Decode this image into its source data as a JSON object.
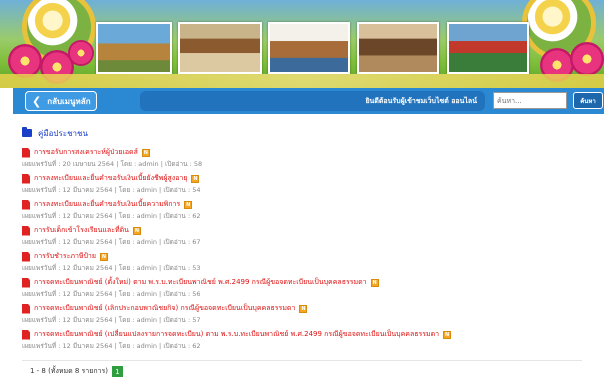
{
  "toolbar": {
    "back_label": "กลับเมนูหลัก",
    "welcome_text": "ยินดีต้อนรับผู้เข้าชมเว็บไซต์ ออนไลน์",
    "search_placeholder": "ค้นหา...",
    "search_button": "ค้นหา"
  },
  "section": {
    "title": "คู่มือประชาชน"
  },
  "items": [
    {
      "title": "การขอรับการสงเคราะห์ผู้ป่วยเอดส์",
      "meta": "เผยแพร่วันที่ : 20 เมษายน 2564 | โดย : admin | เปิดอ่าน : 58",
      "badge": "N"
    },
    {
      "title": "การลงทะเบียนและยื่นคำขอรับเงินเบี้ยยังชีพผู้สูงอายุ",
      "meta": "เผยแพร่วันที่ : 12 มีนาคม 2564 | โดย : admin | เปิดอ่าน : 54",
      "badge": "N"
    },
    {
      "title": "การลงทะเบียนและยื่นคำขอรับเงินเบี้ยความพิการ",
      "meta": "เผยแพร่วันที่ : 12 มีนาคม 2564 | โดย : admin | เปิดอ่าน : 62",
      "badge": "N"
    },
    {
      "title": "การรับเด็กเข้าโรงเรียนและที่ดิน",
      "meta": "เผยแพร่วันที่ : 12 มีนาคม 2564 | โดย : admin | เปิดอ่าน : 67",
      "badge": "N"
    },
    {
      "title": "การรับชำระภาษีป้าย",
      "meta": "เผยแพร่วันที่ : 12 มีนาคม 2564 | โดย : admin | เปิดอ่าน : 53",
      "badge": "N"
    },
    {
      "title": "การจดทะเบียนพาณิชย์ (ตั้งใหม่) ตาม พ.ร.บ.ทะเบียนพาณิชย์ พ.ศ.2499 กรณีผู้ขอจดทะเบียนเป็นบุคคลธรรมดา",
      "meta": "เผยแพร่วันที่ : 12 มีนาคม 2564 | โดย : admin | เปิดอ่าน : 56",
      "badge": "N"
    },
    {
      "title": "การจดทะเบียนพาณิชย์ (เลิกประกอบพาณิชยกิจ) กรณีผู้ขอจดทะเบียนเป็นบุคคลธรรมดา",
      "meta": "เผยแพร่วันที่ : 12 มีนาคม 2564 | โดย : admin | เปิดอ่าน : 57",
      "badge": "N"
    },
    {
      "title": "การจดทะเบียนพาณิชย์ (เปลี่ยนแปลงรายการจดทะเบียน) ตาม พ.ร.บ.ทะเบียนพาณิชย์ พ.ศ.2499 กรณีผู้ขอจดทะเบียนเป็นบุคคลธรรมดา",
      "meta": "เผยแพร่วันที่ : 12 มีนาคม 2564 | โดย : admin | เปิดอ่าน : 62",
      "badge": "N"
    }
  ],
  "pager": {
    "summary": "1 - 8 (ทั้งหมด 8 รายการ)",
    "current_page": "1"
  },
  "colors": {
    "toolbar": "#2b88d2",
    "welcome_bar": "#2173bd",
    "item_title": "#dd1111",
    "section_title": "#1b3fc8",
    "pager_active": "#2e9e3e"
  }
}
